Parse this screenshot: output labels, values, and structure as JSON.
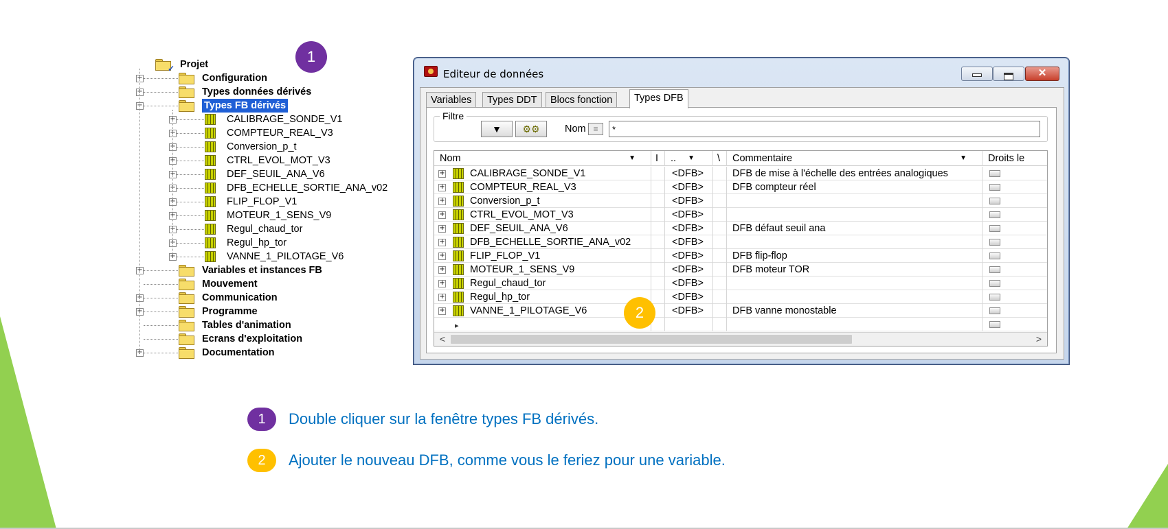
{
  "tree": {
    "root": "Projet",
    "items": [
      {
        "label": "Configuration",
        "expander": "+"
      },
      {
        "label": "Types données dérivés",
        "expander": "+"
      },
      {
        "label": "Types FB dérivés",
        "expander": "−",
        "selected": true
      }
    ],
    "fb_children": [
      "CALIBRAGE_SONDE_V1",
      "COMPTEUR_REAL_V3",
      "Conversion_p_t",
      "CTRL_EVOL_MOT_V3",
      "DEF_SEUIL_ANA_V6",
      "DFB_ECHELLE_SORTIE_ANA_v02",
      "FLIP_FLOP_V1",
      "MOTEUR_1_SENS_V9",
      "Regul_chaud_tor",
      "Regul_hp_tor",
      "VANNE_1_PILOTAGE_V6"
    ],
    "items_after": [
      {
        "label": "Variables et instances FB",
        "expander": "+"
      },
      {
        "label": "Mouvement",
        "expander": ""
      },
      {
        "label": "Communication",
        "expander": "+"
      },
      {
        "label": "Programme",
        "expander": "+"
      },
      {
        "label": "Tables d'animation",
        "expander": ""
      },
      {
        "label": "Ecrans d'exploitation",
        "expander": ""
      },
      {
        "label": "Documentation",
        "expander": "+"
      }
    ]
  },
  "window": {
    "title": "Editeur de données",
    "minimize": "",
    "maximize": "",
    "close": "✕",
    "tabs": [
      "Variables",
      "Types DDT",
      "Blocs fonction",
      "Types DFB"
    ],
    "active_tab": "Types DFB",
    "filter": {
      "legend": "Filtre",
      "funnel_glyph": "▼",
      "gears_glyph": "⚙⚙",
      "nom_label": "Nom",
      "eq_label": "=",
      "value": "*"
    },
    "columns": {
      "nom": "Nom",
      "col2": "I",
      "col3": "..",
      "col4": "\\",
      "commentaire": "Commentaire",
      "droits": "Droits le"
    },
    "rows": [
      {
        "name": "CALIBRAGE_SONDE_V1",
        "type": "<DFB>",
        "comment": "DFB de mise à l'échelle des entrées analogiques"
      },
      {
        "name": "COMPTEUR_REAL_V3",
        "type": "<DFB>",
        "comment": "DFB compteur réel"
      },
      {
        "name": "Conversion_p_t",
        "type": "<DFB>",
        "comment": ""
      },
      {
        "name": "CTRL_EVOL_MOT_V3",
        "type": "<DFB>",
        "comment": ""
      },
      {
        "name": "DEF_SEUIL_ANA_V6",
        "type": "<DFB>",
        "comment": "DFB défaut seuil ana"
      },
      {
        "name": "DFB_ECHELLE_SORTIE_ANA_v02",
        "type": "<DFB>",
        "comment": ""
      },
      {
        "name": "FLIP_FLOP_V1",
        "type": "<DFB>",
        "comment": "DFB flip-flop"
      },
      {
        "name": "MOTEUR_1_SENS_V9",
        "type": "<DFB>",
        "comment": "DFB moteur TOR"
      },
      {
        "name": "Regul_chaud_tor",
        "type": "<DFB>",
        "comment": ""
      },
      {
        "name": "Regul_hp_tor",
        "type": "<DFB>",
        "comment": ""
      },
      {
        "name": "VANNE_1_PILOTAGE_V6",
        "type": "<DFB>",
        "comment": "DFB vanne monostable"
      }
    ],
    "new_row_marker": "▸",
    "scroll_left": "<",
    "scroll_right": ">"
  },
  "badges": {
    "one": "1",
    "two": "2"
  },
  "instructions": [
    {
      "num": "1",
      "text": "Double cliquer sur la fenêtre types FB dérivés."
    },
    {
      "num": "2",
      "text": "Ajouter le nouveau DFB, comme vous le feriez pour une variable."
    }
  ],
  "colors": {
    "purple": "#7030a0",
    "gold": "#ffc000",
    "instruction_blue": "#0070c0",
    "deco_green": "#92d050",
    "selection": "#1f5fd6"
  }
}
